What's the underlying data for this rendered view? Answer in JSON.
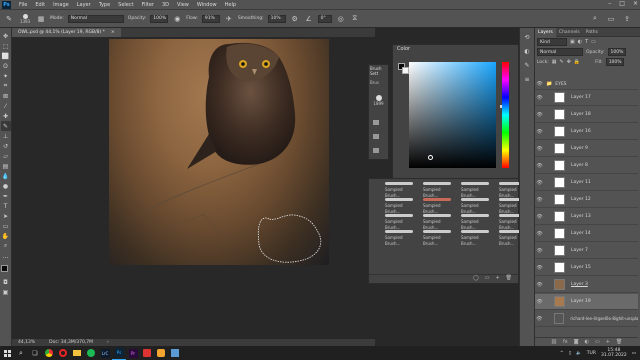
{
  "menubar": {
    "items": [
      "File",
      "Edit",
      "Image",
      "Layer",
      "Type",
      "Select",
      "Filter",
      "3D",
      "View",
      "Window",
      "Help"
    ]
  },
  "options": {
    "brush_size": "1393",
    "mode_label": "Mode:",
    "mode_value": "Normal",
    "opacity_label": "Opacity:",
    "opacity_value": "100%",
    "flow_label": "Flow:",
    "flow_value": "91%",
    "smoothing_label": "Smoothing:",
    "smoothing_value": "10%",
    "angle_value": "0°"
  },
  "document": {
    "tab_title": "OWL.psd @ 44,1% (Layer 19, RGB/8) *",
    "zoom": "44,13%",
    "doc_size": "Doc: 34,3M/370,7M"
  },
  "brush_panel": {
    "title": "Brush Sett",
    "tab2": "Brus",
    "size_value": "1899"
  },
  "color_panel": {
    "title": "Color"
  },
  "brush_grid": {
    "items": [
      "Sampled Brush...",
      "Sampled Brush...",
      "Sampled Brush...",
      "Sampled Brush...",
      "Sampled Brush...",
      "Sampled Brush...",
      "Sampled Brush...",
      "Sampled Brush...",
      "Sampled Brush...",
      "Sampled Brush...",
      "Sampled Brush...",
      "Sampled Brush...",
      "Sampled Brush...",
      "Sampled Brush...",
      "Sampled Brush...",
      "Sampled Brush..."
    ]
  },
  "layers_panel": {
    "tabs": [
      "Layers",
      "Channels",
      "Paths"
    ],
    "filter_value": "Kind",
    "blend_value": "Normal",
    "opacity_label": "Opacity:",
    "opacity_value": "100%",
    "lock_label": "Lock:",
    "fill_label": "Fill:",
    "fill_value": "100%",
    "group_name": "EYES",
    "layers": [
      "Layer 17",
      "Layer 18",
      "Layer 16",
      "Layer 9",
      "Layer 8",
      "Layer 11",
      "Layer 12",
      "Layer 13",
      "Layer 14",
      "Layer 7",
      "Layer 15",
      "Layer 3",
      "Layer 19",
      "richard-lee-4rgxeI0o-8ighit-unsplash"
    ],
    "selected_index": 12
  },
  "taskbar": {
    "time": "15:48",
    "date": "31.07.2022",
    "lang": "TUR"
  },
  "colors": {
    "accent": "#31a8ff",
    "panel": "#535353",
    "dark": "#282828",
    "selected": "#6a6a6a"
  }
}
